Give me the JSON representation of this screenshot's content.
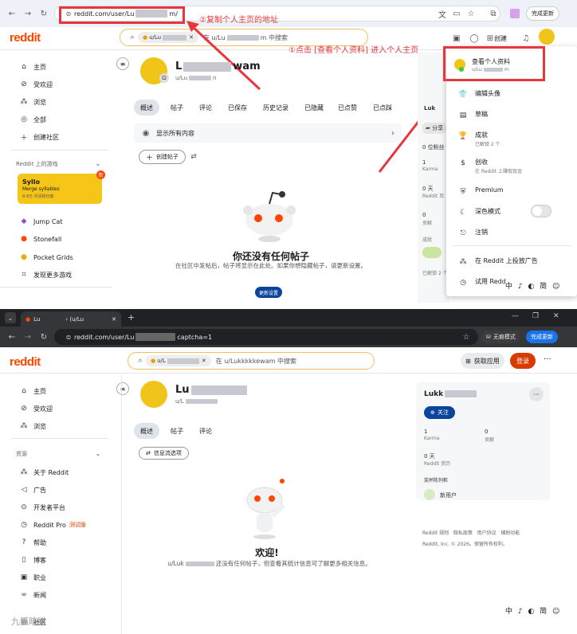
{
  "top": {
    "browser": {
      "url": "reddit.com/user/Lu",
      "url_tail": "m/",
      "profile_btn": "完成更新"
    },
    "reddit": {
      "logo": "reddit",
      "search_chip": "u/Lu",
      "search_placeholder": "在 u/Lu",
      "search_suffix": "m 中搜索",
      "create": "创建"
    },
    "annotations": {
      "step2": "②复制个人主页的地址",
      "step1": "①点击 [查看个人资料] 进入个人主页"
    },
    "sidebar": {
      "items": [
        "主页",
        "受欢迎",
        "浏览",
        "全部"
      ],
      "create_community": "创建社区",
      "games_header": "Reddit 上的游戏",
      "game_card": {
        "title": "Syllo",
        "sub": "Merge syllables",
        "meta": "9.4万 月活跃玩家",
        "badge": "新"
      },
      "games": [
        "Jump Cat",
        "Stonefall",
        "Pocket Grids",
        "发现更多游戏"
      ]
    },
    "profile": {
      "name_start": "L",
      "name_end": "wam",
      "handle": "u/Lu",
      "handle_tail": "n"
    },
    "tabs": [
      "概述",
      "帖子",
      "评论",
      "已保存",
      "历史记录",
      "已隐藏",
      "已点赞",
      "已点踩"
    ],
    "show_all": "显示所有内容",
    "create_post": "创建帖子",
    "empty": {
      "title": "你还没有任何帖子",
      "desc": "在社区中发帖后，帖子将显示在此处。如果你想隐藏帖子，请更新设置。",
      "button": "更新设置"
    },
    "right": {
      "name": "Luk",
      "share": "分享",
      "followers": "0 位粉丝",
      "karma_val": "1",
      "karma_label": "Karma",
      "days_val": "0 天",
      "days_label": "Reddit 页",
      "zero": "0",
      "zero_label": "贡献",
      "achievements": "成就",
      "unlocked": "已解锁 2 个"
    },
    "menu": {
      "view_profile": "查看个人资料",
      "view_handle": "u/Lu",
      "view_tail": "m",
      "items": [
        {
          "label": "编辑头像",
          "sub": ""
        },
        {
          "label": "草稿",
          "sub": ""
        },
        {
          "label": "成就",
          "sub": "已解锁 2 个"
        },
        {
          "label": "创收",
          "sub": "在 Reddit 上赚取现金"
        },
        {
          "label": "Premium",
          "sub": ""
        },
        {
          "label": "深色模式",
          "sub": ""
        },
        {
          "label": "注销",
          "sub": ""
        },
        {
          "label": "在 Reddit 上投放广告",
          "sub": ""
        },
        {
          "label": "试用 Redd",
          "sub": ""
        }
      ]
    },
    "ime": "中 ♪ ◐ 简 ☺"
  },
  "bottom": {
    "browser": {
      "tab_title": "Lu",
      "tab2": "› (u/Lu",
      "url": "reddit.com/user/Lu",
      "url_tail": "captcha=1",
      "incognito": "无痕模式",
      "profile_btn": "完成更新"
    },
    "reddit": {
      "logo": "reddit",
      "search_chip": "u/L",
      "search_placeholder": "在 u/Lukkkkkewam 中搜索",
      "get_app": "获取应用",
      "login": "登录"
    },
    "sidebar": {
      "items": [
        "主页",
        "受欢迎",
        "浏览"
      ],
      "resources": "资源",
      "res_items": [
        "关于 Reddit",
        "广告",
        "开发者平台",
        "Reddit Pro",
        "帮助",
        "博客",
        "职业",
        "新闻"
      ],
      "pro_badge": "测试版",
      "cut": "社区"
    },
    "profile": {
      "name_start": "Lu",
      "handle": "u/L"
    },
    "tabs": [
      "概述",
      "帖子",
      "评论"
    ],
    "feed_options": "信息流选项",
    "empty": {
      "title": "欢迎!",
      "desc_lead": "u/Luk",
      "desc": "还没有任何帖子，但查看其统计信息可了解更多相关信息。"
    },
    "right": {
      "name": "Lukk",
      "follow": "关注",
      "karma_val": "1",
      "karma_label": "Karma",
      "contrib_val": "0",
      "contrib_label": "贡献",
      "days_val": "0 天",
      "days_label": "Reddit 资历",
      "achievements": "奖杯陈列柜",
      "trophy": "新用户"
    },
    "footer": {
      "line1": "Reddit 规则   隐私政策   用户协议   辅助功能",
      "line2": "Reddit, Inc. © 2026。保留所有权利。"
    },
    "watermark": "九狐暗猎",
    "ime": "中 ♪ ◐ 简 ☺"
  }
}
